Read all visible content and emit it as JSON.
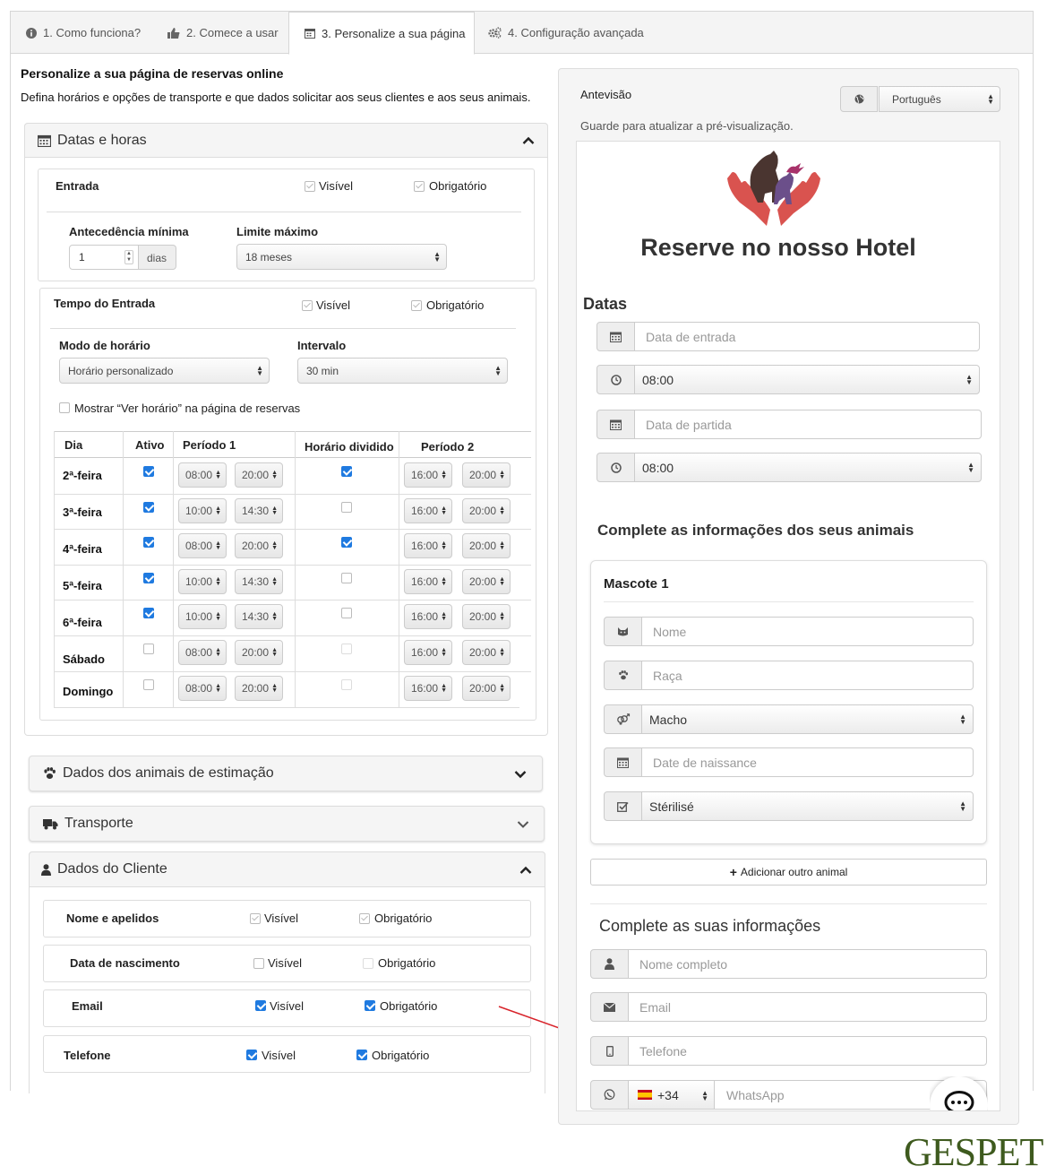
{
  "tabs": [
    {
      "label": "1. Como funciona?",
      "icon": "info-icon"
    },
    {
      "label": "2. Comece a usar",
      "icon": "thumbs-up-icon"
    },
    {
      "label": "3. Personalize a sua página",
      "icon": "calendar-icon"
    },
    {
      "label": "4. Configuração avançada",
      "icon": "gears-icon"
    }
  ],
  "page": {
    "title": "Personalize a sua página de reservas online",
    "subtitle": "Defina horários e opções de transporte e que dados solicitar aos seus clientes e aos seus animais."
  },
  "dates_panel": {
    "title": "Datas e horas",
    "visible_label": "Visível",
    "required_label": "Obrigatório",
    "entrada": {
      "label": "Entrada",
      "min_advance_label": "Antecedência mínima",
      "min_advance_value": "1",
      "min_advance_unit": "dias",
      "max_limit_label": "Limite máximo",
      "max_limit_value": "18 meses"
    },
    "time": {
      "label": "Tempo do Entrada",
      "mode_label": "Modo de horário",
      "mode_value": "Horário personalizado",
      "interval_label": "Intervalo",
      "interval_value": "30 min",
      "show_hours_label": "Mostrar “Ver horário” na página de reservas"
    },
    "schedule": {
      "headers": [
        "Dia",
        "Ativo",
        "Período 1",
        "Horário dividido",
        "Período 2"
      ],
      "rows": [
        {
          "day": "2ª-feira",
          "active": true,
          "p1_start": "08:00",
          "p1_end": "20:00",
          "split": true,
          "p2_start": "16:00",
          "p2_end": "20:00"
        },
        {
          "day": "3ª-feira",
          "active": true,
          "p1_start": "10:00",
          "p1_end": "14:30",
          "split": false,
          "p2_start": "16:00",
          "p2_end": "20:00"
        },
        {
          "day": "4ª-feira",
          "active": true,
          "p1_start": "08:00",
          "p1_end": "20:00",
          "split": true,
          "p2_start": "16:00",
          "p2_end": "20:00"
        },
        {
          "day": "5ª-feira",
          "active": true,
          "p1_start": "10:00",
          "p1_end": "14:30",
          "split": false,
          "p2_start": "16:00",
          "p2_end": "20:00"
        },
        {
          "day": "6ª-feira",
          "active": true,
          "p1_start": "10:00",
          "p1_end": "14:30",
          "split": false,
          "p2_start": "16:00",
          "p2_end": "20:00"
        },
        {
          "day": "Sábado",
          "active": false,
          "p1_start": "08:00",
          "p1_end": "20:00",
          "split": false,
          "p2_start": "16:00",
          "p2_end": "20:00"
        },
        {
          "day": "Domingo",
          "active": false,
          "p1_start": "08:00",
          "p1_end": "20:00",
          "split": false,
          "p2_start": "16:00",
          "p2_end": "20:00"
        }
      ]
    }
  },
  "pets_panel": {
    "title": "Dados dos animais de estimação"
  },
  "transport_panel": {
    "title": "Transporte"
  },
  "client_panel": {
    "title": "Dados do Cliente",
    "fields": [
      {
        "label": "Nome e apelidos",
        "visible": "locked",
        "required": "locked"
      },
      {
        "label": "Data de nascimento",
        "visible": "off",
        "required": "disabled"
      },
      {
        "label": "Email",
        "visible": "on",
        "required": "on"
      },
      {
        "label": "Telefone",
        "visible": "on",
        "required": "on"
      }
    ]
  },
  "preview": {
    "title": "Antevisão",
    "language": "Português",
    "note": "Guarde para atualizar a pré-visualização.",
    "hotel_title": "Reserve no nosso Hotel",
    "dates_heading": "Datas",
    "checkin_placeholder": "Data de entrada",
    "checkin_time": "08:00",
    "checkout_placeholder": "Data de partida",
    "checkout_time": "08:00",
    "animals_heading": "Complete as informações dos seus animais",
    "pet_title": "Mascote 1",
    "pet_name_placeholder": "Nome",
    "pet_breed_placeholder": "Raça",
    "pet_sex": "Macho",
    "pet_birth_placeholder": "Date de naissance",
    "pet_sterilized": "Stérilisé",
    "add_animal": "Adicionar outro animal",
    "info_heading": "Complete as suas informações",
    "fullname_placeholder": "Nome completo",
    "email_placeholder": "Email",
    "phone_placeholder": "Telefone",
    "dial_code": "+34",
    "whatsapp_placeholder": "WhatsApp"
  },
  "brand": {
    "logo_text": "GESPET",
    "logo_color": "#3e5a1e",
    "accent": "#1f7ae0",
    "arrow_color": "#d8232a"
  }
}
